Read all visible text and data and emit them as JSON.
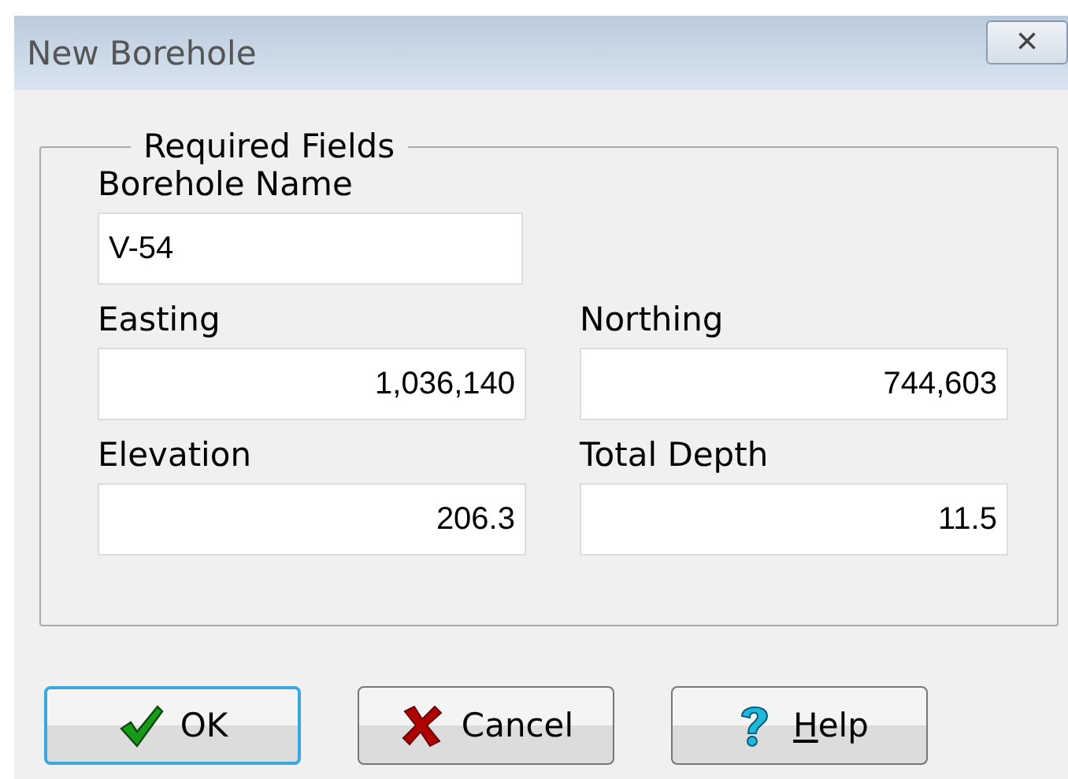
{
  "window": {
    "title": "New Borehole",
    "close": "×"
  },
  "group": {
    "title": "Required Fields",
    "fields": [
      {
        "kind": "text",
        "label": "Borehole Name",
        "value": "V-54"
      },
      {
        "kind": "number",
        "label": "Easting",
        "value": "1,036,140"
      },
      {
        "kind": "number",
        "label": "Northing",
        "value": "744,603"
      },
      {
        "kind": "number",
        "label": "Elevation",
        "value": "206.3"
      },
      {
        "kind": "number",
        "label": "Total Depth",
        "value": "11.5"
      }
    ]
  },
  "buttons": [
    {
      "kind": "ok",
      "label": "OK",
      "focused": true,
      "access_key_underlined": false
    },
    {
      "kind": "cancel",
      "label": "Cancel",
      "focused": false,
      "access_key_underlined": false
    },
    {
      "kind": "help",
      "label": "Help",
      "focused": false,
      "access_key_underlined": true
    }
  ]
}
